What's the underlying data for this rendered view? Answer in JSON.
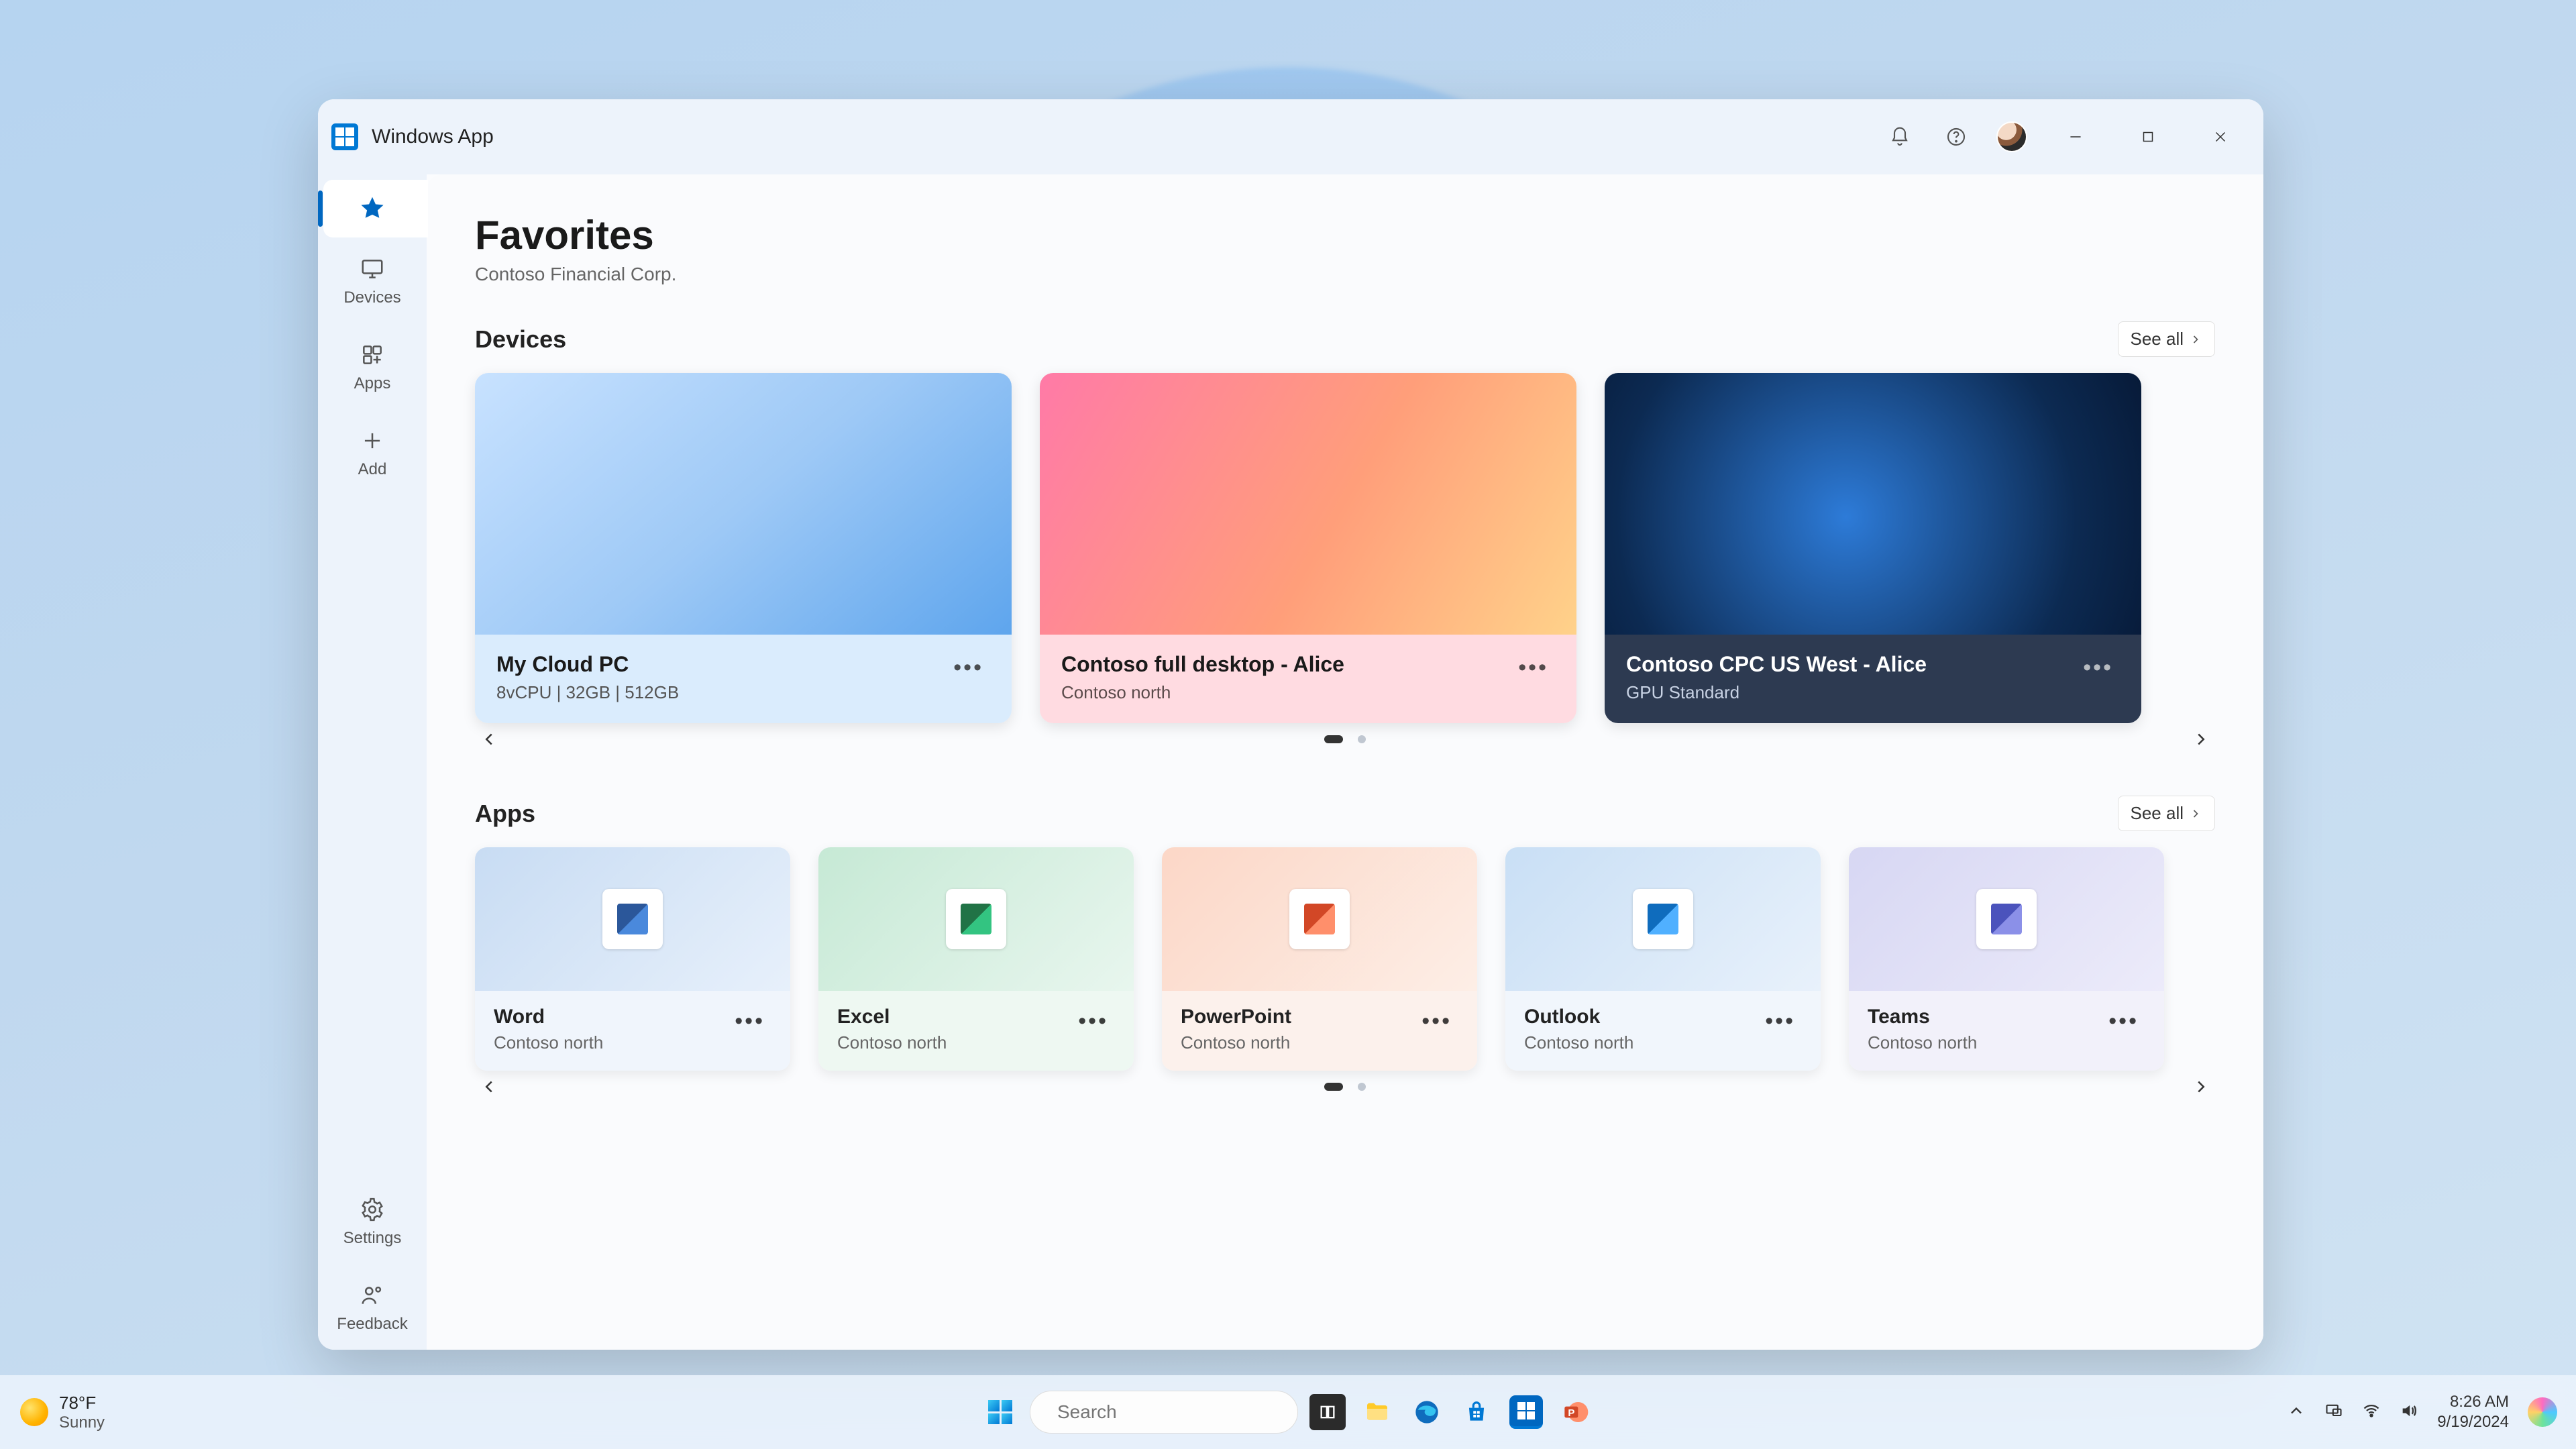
{
  "window": {
    "title": "Windows App"
  },
  "sidebar": {
    "items": [
      {
        "label": "",
        "name": "favorites"
      },
      {
        "label": "Devices",
        "name": "devices"
      },
      {
        "label": "Apps",
        "name": "apps"
      },
      {
        "label": "Add",
        "name": "add"
      }
    ],
    "footer": [
      {
        "label": "Settings",
        "name": "settings"
      },
      {
        "label": "Feedback",
        "name": "feedback"
      }
    ]
  },
  "page": {
    "title": "Favorites",
    "subtitle": "Contoso Financial Corp."
  },
  "sections": {
    "devices": {
      "title": "Devices",
      "see_all": "See all",
      "items": [
        {
          "name": "My Cloud PC",
          "sub": "8vCPU | 32GB | 512GB"
        },
        {
          "name": "Contoso full desktop - Alice",
          "sub": "Contoso north"
        },
        {
          "name": "Contoso CPC US West - Alice",
          "sub": "GPU Standard"
        }
      ]
    },
    "apps": {
      "title": "Apps",
      "see_all": "See all",
      "items": [
        {
          "name": "Word",
          "sub": "Contoso north"
        },
        {
          "name": "Excel",
          "sub": "Contoso north"
        },
        {
          "name": "PowerPoint",
          "sub": "Contoso north"
        },
        {
          "name": "Outlook",
          "sub": "Contoso north"
        },
        {
          "name": "Teams",
          "sub": "Contoso north"
        }
      ]
    }
  },
  "taskbar": {
    "weather": {
      "temp": "78°F",
      "cond": "Sunny"
    },
    "search_placeholder": "Search",
    "time": "8:26 AM",
    "date": "9/19/2024"
  }
}
